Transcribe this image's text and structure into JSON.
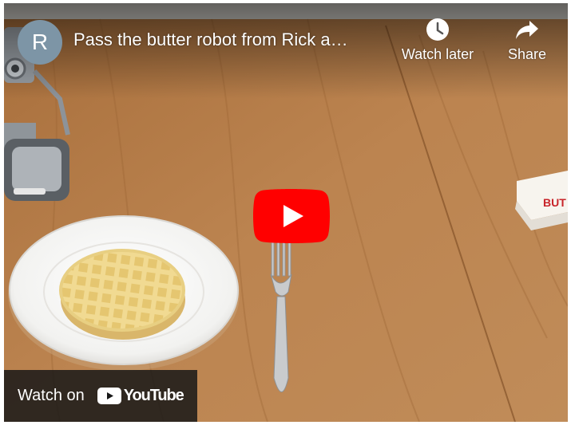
{
  "video": {
    "channel_initial": "R",
    "title": "Pass the butter robot from Rick a…"
  },
  "actions": {
    "watch_later": "Watch later",
    "share": "Share"
  },
  "footer": {
    "watch_on": "Watch on",
    "brand": "YouTube"
  },
  "scene": {
    "butter_packet_text": "BUT"
  },
  "colors": {
    "play_red": "#ff0000",
    "avatar_bg": "#7d95a6",
    "table_wood": "#b37a45"
  },
  "icons": {
    "watch_later": "clock-icon",
    "share": "share-arrow-icon",
    "play": "play-icon",
    "brand": "youtube-logo-icon"
  }
}
